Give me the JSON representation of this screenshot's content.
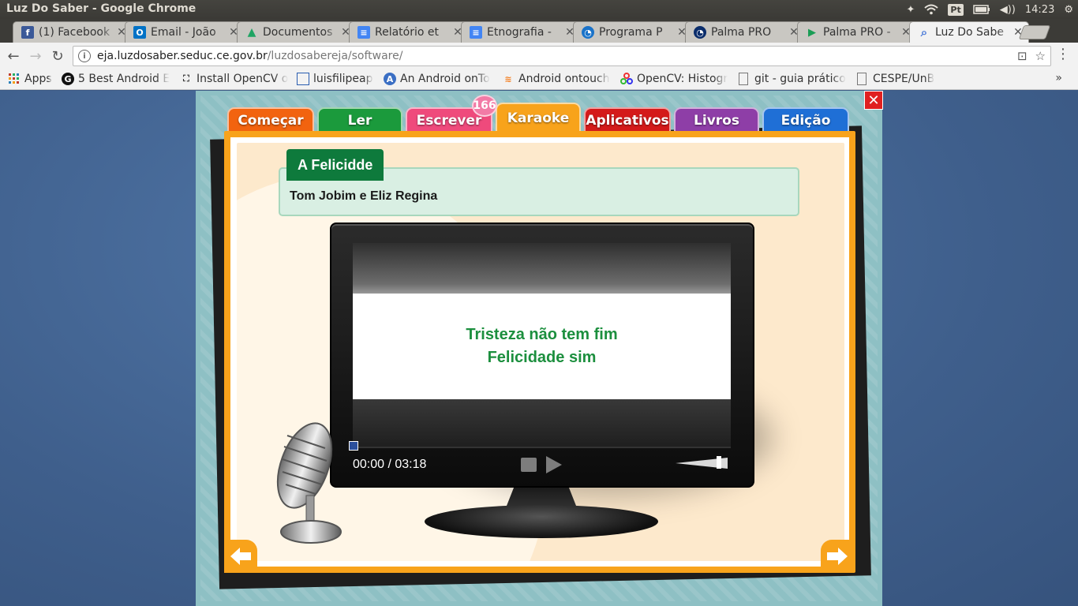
{
  "os": {
    "window_title": "Luz Do Saber - Google Chrome",
    "keyboard_layout": "Pt",
    "clock": "14:23"
  },
  "browser": {
    "tabs": [
      {
        "label": "(1) Facebook",
        "icon": "facebook-icon",
        "color": "#3b5998",
        "glyph": "f"
      },
      {
        "label": "Email - João",
        "icon": "outlook-icon",
        "color": "#0072c6",
        "glyph": "O"
      },
      {
        "label": "Documentos",
        "icon": "google-drive-icon",
        "color": "#1fa463",
        "glyph": "▲"
      },
      {
        "label": "Relatório et",
        "icon": "google-docs-icon",
        "color": "#4285f4",
        "glyph": "≡"
      },
      {
        "label": "Etnografia -",
        "icon": "google-docs-icon",
        "color": "#4285f4",
        "glyph": "≡"
      },
      {
        "label": "Programa P",
        "icon": "palma-icon",
        "color": "#1a73c9",
        "glyph": "◔"
      },
      {
        "label": "Palma PRO",
        "icon": "palma-icon",
        "color": "#0b2d6b",
        "glyph": "◔"
      },
      {
        "label": "Palma PRO -",
        "icon": "google-play-icon",
        "color": "#1a9d55",
        "glyph": "▶"
      },
      {
        "label": "Luz Do Sabe",
        "icon": "search-icon",
        "color": "#4a7ad8",
        "glyph": "⌕"
      }
    ],
    "url_host": "eja.luzdosaber.seduc.ce.gov.br",
    "url_path": "/luzdosabereja/software/",
    "bookmarks": [
      {
        "label": "Apps",
        "icon": "apps-grid-icon"
      },
      {
        "label": "5 Best Android E",
        "icon": "g-icon"
      },
      {
        "label": "Install OpenCV o",
        "icon": "bookmark-icon"
      },
      {
        "label": "luisfilipeap",
        "icon": "page-icon"
      },
      {
        "label": "An Android onTo",
        "icon": "a-icon"
      },
      {
        "label": "Android ontouch",
        "icon": "stackoverflow-icon"
      },
      {
        "label": "OpenCV: Histogr",
        "icon": "opencv-icon"
      },
      {
        "label": "git - guia prático",
        "icon": "page-icon"
      },
      {
        "label": "CESPE/UnB",
        "icon": "page-icon"
      }
    ],
    "bookmarks_more": "»"
  },
  "app": {
    "close_label": "✕",
    "badge_count": "166",
    "tabs": [
      {
        "label": "Começar",
        "color": "#f2630f"
      },
      {
        "label": "Ler",
        "color": "#1b9a3c"
      },
      {
        "label": "Escrever",
        "color": "#ef4a7c"
      },
      {
        "label": "Karaoke",
        "color": "#f8a31b"
      },
      {
        "label": "Aplicativos",
        "color": "#d41a1a"
      },
      {
        "label": "Livros",
        "color": "#8e3ea7"
      },
      {
        "label": "Edição",
        "color": "#1f6fd6"
      }
    ],
    "song": {
      "title": "A Felicidde",
      "artist": "Tom Jobim e Eliz Regina"
    },
    "lyrics": [
      "Tristeza não tem fim",
      "Felicidade sim"
    ],
    "player": {
      "time": "00:00 / 03:18",
      "progress": 0,
      "volume": 0.8
    }
  }
}
